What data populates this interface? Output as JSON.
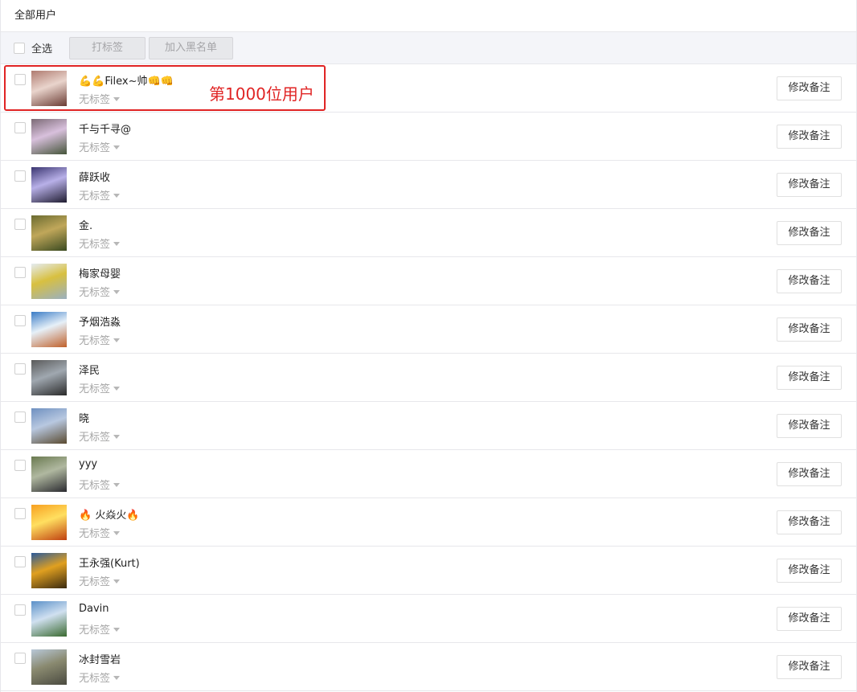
{
  "header": {
    "title": "全部用户"
  },
  "toolbar": {
    "select_all": "全选",
    "tag_button": "打标签",
    "blacklist_button": "加入黑名单"
  },
  "annotation": {
    "note": "第1000位用户"
  },
  "tag_default": "无标签",
  "remark_button": "修改备注",
  "users": [
    {
      "name": "💪💪Filex~帅👊👊",
      "avatar_colors": [
        "#b07b70",
        "#e9d4cc",
        "#6a3b33"
      ]
    },
    {
      "name": "千与千寻@",
      "avatar_colors": [
        "#7b6a75",
        "#d8c0dc",
        "#45553a"
      ]
    },
    {
      "name": "薛跃收",
      "avatar_colors": [
        "#3a3570",
        "#b8b0e8",
        "#1f1c30"
      ]
    },
    {
      "name": "金.",
      "avatar_colors": [
        "#6a6b30",
        "#c0a75a",
        "#3a4a20"
      ]
    },
    {
      "name": "梅家母婴",
      "avatar_colors": [
        "#e5ecf2",
        "#d8c040",
        "#9ab0c0"
      ]
    },
    {
      "name": "予烟浩淼",
      "avatar_colors": [
        "#3a7cc6",
        "#e6f0f8",
        "#c0602a"
      ]
    },
    {
      "name": "泽民",
      "avatar_colors": [
        "#5a5a5a",
        "#a0a8b0",
        "#2a2a2a"
      ]
    },
    {
      "name": "晓",
      "avatar_colors": [
        "#6e90c0",
        "#b8c8e0",
        "#5a4a30"
      ]
    },
    {
      "name": "yyy",
      "avatar_colors": [
        "#6a7a50",
        "#b0b8a0",
        "#2a2a30"
      ]
    },
    {
      "name": "🔥 火焱火🔥",
      "avatar_colors": [
        "#f7a020",
        "#ffdf60",
        "#c04010"
      ]
    },
    {
      "name": "王永强(Kurt)",
      "avatar_colors": [
        "#2a5a9a",
        "#e0a020",
        "#3a2a10"
      ]
    },
    {
      "name": "Davin",
      "avatar_colors": [
        "#5a90c8",
        "#d0e0f0",
        "#3a6a30"
      ]
    },
    {
      "name": "冰封雪岩",
      "avatar_colors": [
        "#b8c8d8",
        "#8a8a70",
        "#4a4a40"
      ]
    }
  ]
}
